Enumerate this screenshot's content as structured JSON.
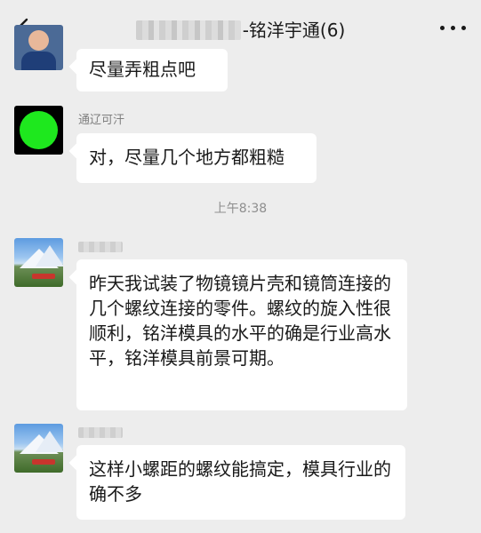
{
  "header": {
    "title_visible": "-铭洋宇通(6)",
    "back_icon": "chevron-left-icon",
    "more_icon": "more-dots-icon"
  },
  "messages": [
    {
      "sender": "",
      "text": "尽量弄粗点吧"
    },
    {
      "sender": "通辽可汗",
      "text": "对，尽量几个地方都粗糙"
    },
    {
      "sender": "",
      "text": "昨天我试装了物镜镜片壳和镜筒连接的几个螺纹连接的零件。螺纹的旋入性很顺利，铭洋模具的水平的确是行业高水平，铭洋模具前景可期。"
    },
    {
      "sender": "",
      "text": "这样小螺距的螺纹能搞定，模具行业的确不多"
    }
  ],
  "timestamp": "上午8:38",
  "colors": {
    "background": "#ededed",
    "bubble": "#ffffff",
    "text": "#191919",
    "meta": "#8e8e8e"
  }
}
